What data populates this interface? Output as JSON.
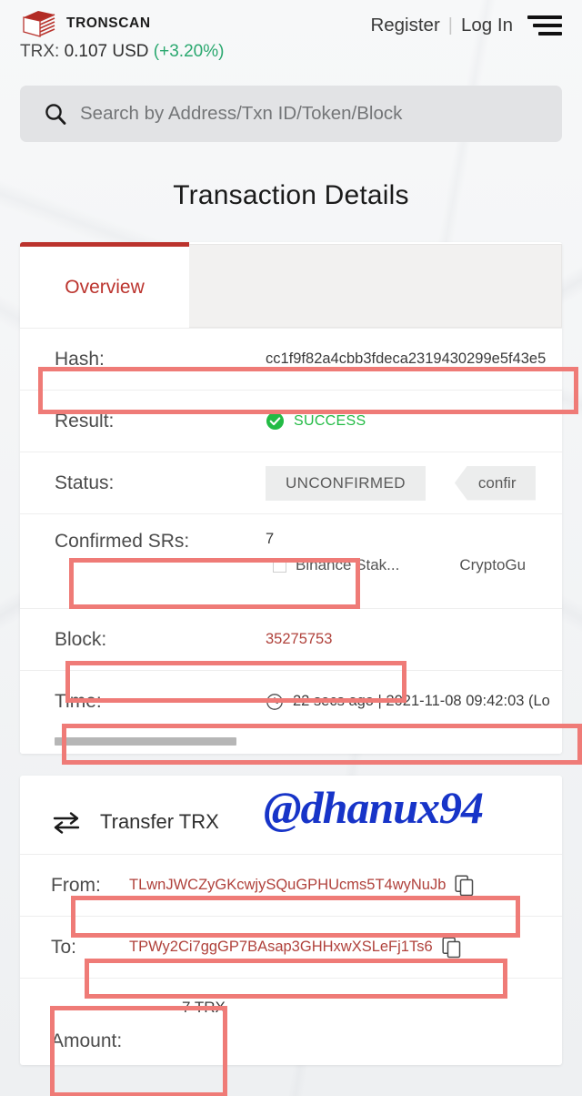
{
  "header": {
    "brand": "TRONSCAN",
    "logo_icon": "tronscan-cube-icon",
    "register_label": "Register",
    "separator": "|",
    "login_label": "Log In",
    "menu_icon": "hamburger-menu-icon",
    "price_label": "TRX:",
    "price_value": "0.107 USD",
    "price_change": "(+3.20%)",
    "price_change_color": "#2aa86f"
  },
  "search": {
    "icon": "search-icon",
    "placeholder": "Search by Address/Txn ID/Token/Block"
  },
  "page": {
    "title": "Transaction Details"
  },
  "tabs": [
    {
      "label": "Overview",
      "active": true
    }
  ],
  "overview": {
    "rows": [
      {
        "label": "Hash:",
        "value": "cc1f9f82a4cbb3fdeca2319430299e5f43e5"
      },
      {
        "label": "Result:",
        "value": "SUCCESS",
        "icon": "check-circle-icon",
        "color": "#23bb45"
      },
      {
        "label": "Status:",
        "chip": "UNCONFIRMED",
        "chip2": "confir"
      },
      {
        "label": "Confirmed SRs:",
        "value": "7",
        "sr_list": [
          "Binance Stak...",
          "CryptoGu"
        ]
      },
      {
        "label": "Block:",
        "value": "35275753",
        "color": "#b0423c"
      },
      {
        "label": "Time:",
        "value": "22 secs ago | 2021-11-08 09:42:03 (Lo",
        "icon": "clock-icon"
      }
    ]
  },
  "transfer": {
    "icon": "transfer-arrows-icon",
    "title": "Transfer TRX",
    "watermark": "@dhanux94",
    "watermark_color": "#1734c8",
    "rows": [
      {
        "label": "From:",
        "value": "TLwnJWCZyGKcwjySQuGPHUcms5T4wyNuJb",
        "copy_icon": "copy-icon"
      },
      {
        "label": "To:",
        "value": "TPWy2Ci7ggGP7BAsap3GHHxwXSLeFj1Ts6",
        "copy_icon": "copy-icon"
      },
      {
        "label": "Amount:",
        "value": "7 TRX"
      }
    ]
  },
  "annotations": {
    "color": "#ef7b77",
    "boxes": [
      "hash-row",
      "confirmed-srs-row",
      "block-row",
      "time-row",
      "from-row",
      "to-row",
      "amount-row"
    ]
  }
}
